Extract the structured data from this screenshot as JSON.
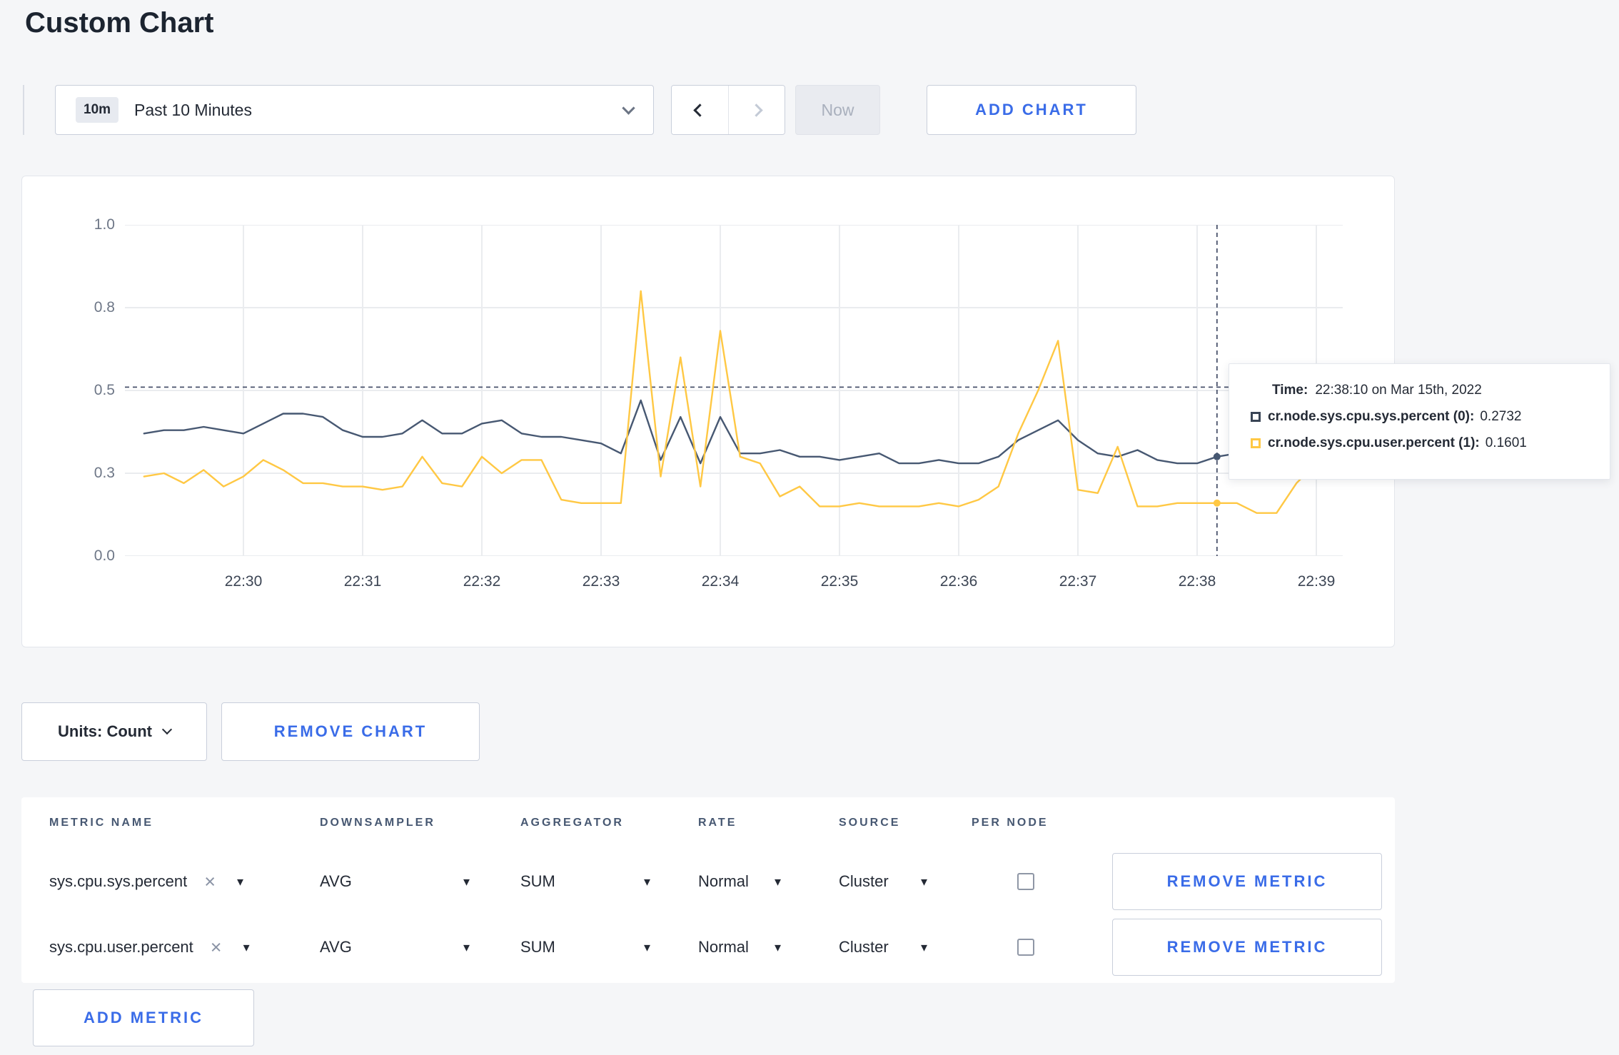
{
  "page": {
    "title": "Custom Chart"
  },
  "colors": {
    "accent": "#3a6ce8",
    "series_sys": "#475872",
    "series_user": "#ffc844",
    "background": "#f5f6f8"
  },
  "icons": {
    "close": "×",
    "caret": "▾"
  },
  "toolbar": {
    "range_badge": "10m",
    "range_label": "Past 10 Minutes",
    "now_label": "Now",
    "add_chart_label": "ADD CHART"
  },
  "tooltip": {
    "time_label": "Time:",
    "time_value": "22:38:10 on Mar 15th, 2022",
    "rows": [
      {
        "label": "cr.node.sys.cpu.sys.percent (0):",
        "value": "0.2732",
        "color": "#394455"
      },
      {
        "label": "cr.node.sys.cpu.user.percent (1):",
        "value": "0.1601",
        "color": "#ffc844"
      }
    ]
  },
  "controls": {
    "units_label": "Units: Count",
    "remove_chart_label": "REMOVE CHART",
    "add_metric_label": "ADD METRIC"
  },
  "table": {
    "headers": [
      "METRIC NAME",
      "DOWNSAMPLER",
      "AGGREGATOR",
      "RATE",
      "SOURCE",
      "PER NODE"
    ],
    "rows": [
      {
        "metric": "sys.cpu.sys.percent",
        "downsampler": "AVG",
        "aggregator": "SUM",
        "rate": "Normal",
        "source": "Cluster",
        "per_node_checked": false,
        "action": "REMOVE METRIC"
      },
      {
        "metric": "sys.cpu.user.percent",
        "downsampler": "AVG",
        "aggregator": "SUM",
        "rate": "Normal",
        "source": "Cluster",
        "per_node_checked": false,
        "action": "REMOVE METRIC"
      }
    ]
  },
  "chart_data": {
    "type": "line",
    "title": "",
    "xlabel": "",
    "ylabel": "",
    "ylim": [
      0,
      1
    ],
    "grid": true,
    "x_ticks": [
      "22:30",
      "22:31",
      "22:32",
      "22:33",
      "22:34",
      "22:35",
      "22:36",
      "22:37",
      "22:38",
      "22:39"
    ],
    "y_ticks": [
      {
        "label": "0.0",
        "frac": 0
      },
      {
        "label": "0.3",
        "frac": 0.25
      },
      {
        "label": "0.5",
        "frac": 0.5
      },
      {
        "label": "0.8",
        "frac": 0.75
      },
      {
        "label": "1.0",
        "frac": 1
      }
    ],
    "points_per_minute": 6,
    "first_tick_index": 5,
    "crosshair": {
      "index": 54,
      "time": "22:38:10",
      "h_line_value": 0.51
    },
    "series": [
      {
        "name": "cr.node.sys.cpu.sys.percent",
        "color": "#475872",
        "values": [
          0.37,
          0.38,
          0.38,
          0.39,
          0.38,
          0.37,
          0.4,
          0.43,
          0.43,
          0.42,
          0.38,
          0.36,
          0.36,
          0.37,
          0.41,
          0.37,
          0.37,
          0.4,
          0.41,
          0.37,
          0.36,
          0.36,
          0.35,
          0.34,
          0.31,
          0.47,
          0.29,
          0.42,
          0.28,
          0.42,
          0.31,
          0.31,
          0.32,
          0.3,
          0.3,
          0.29,
          0.3,
          0.31,
          0.28,
          0.28,
          0.29,
          0.28,
          0.28,
          0.3,
          0.35,
          0.38,
          0.41,
          0.35,
          0.31,
          0.3,
          0.32,
          0.29,
          0.28,
          0.28,
          0.3,
          0.31,
          0.29,
          0.3,
          0.3,
          0.31
        ]
      },
      {
        "name": "cr.node.sys.cpu.user.percent",
        "color": "#ffc844",
        "values": [
          0.24,
          0.25,
          0.22,
          0.26,
          0.21,
          0.24,
          0.29,
          0.26,
          0.22,
          0.22,
          0.21,
          0.21,
          0.2,
          0.21,
          0.3,
          0.22,
          0.21,
          0.3,
          0.25,
          0.29,
          0.29,
          0.17,
          0.16,
          0.16,
          0.16,
          0.8,
          0.24,
          0.6,
          0.21,
          0.68,
          0.3,
          0.28,
          0.18,
          0.21,
          0.15,
          0.15,
          0.16,
          0.15,
          0.15,
          0.15,
          0.16,
          0.15,
          0.17,
          0.21,
          0.37,
          0.5,
          0.65,
          0.2,
          0.19,
          0.33,
          0.15,
          0.15,
          0.16,
          0.16,
          0.16,
          0.16,
          0.13,
          0.13,
          0.22,
          0.28
        ]
      }
    ]
  }
}
